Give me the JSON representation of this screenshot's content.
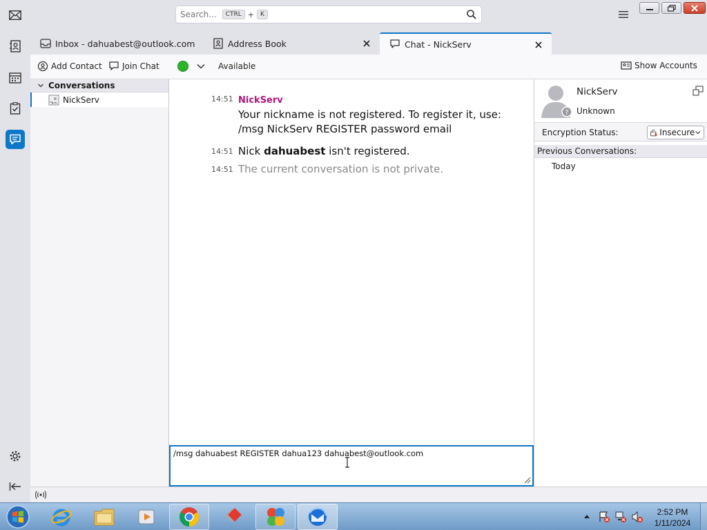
{
  "search": {
    "placeholder": "Search...",
    "key1": "CTRL",
    "plus": "+",
    "key2": "K"
  },
  "tabs": [
    {
      "label": "Inbox - dahuabest@outlook.com",
      "icon": "inbox-icon"
    },
    {
      "label": "Address Book",
      "icon": "address-book-icon"
    },
    {
      "label": "Chat - NickServ",
      "icon": "chat-icon"
    }
  ],
  "toolbar": {
    "add_contact": "Add Contact",
    "join_chat": "Join Chat",
    "status": "Available",
    "status_color": "#2bb52b",
    "show_accounts": "Show Accounts"
  },
  "conversations": {
    "header": "Conversations",
    "items": [
      "NickServ"
    ]
  },
  "messages": [
    {
      "time": "14:51",
      "sender": "NickServ",
      "text": "Your nickname is not registered. To register it, use: /msg NickServ REGISTER password email"
    },
    {
      "time": "14:51",
      "prefix": "Nick ",
      "bold": "dahuabest",
      "suffix": " isn't registered."
    },
    {
      "time": "14:51",
      "text": "The current conversation is not private."
    }
  ],
  "input": {
    "value": "/msg dahuabest REGISTER dahua123 dahuabest@outlook.com"
  },
  "info": {
    "name": "NickServ",
    "status": "Unknown",
    "encryption_label": "Encryption Status:",
    "encryption_value": "Insecure",
    "prev_header": "Previous Conversations:",
    "prev_items": [
      "Today"
    ]
  },
  "clock": {
    "time": "2:52 PM",
    "date": "1/11/2024"
  },
  "colors": {
    "accent": "#0e77c7",
    "sender": "#b0157b"
  }
}
